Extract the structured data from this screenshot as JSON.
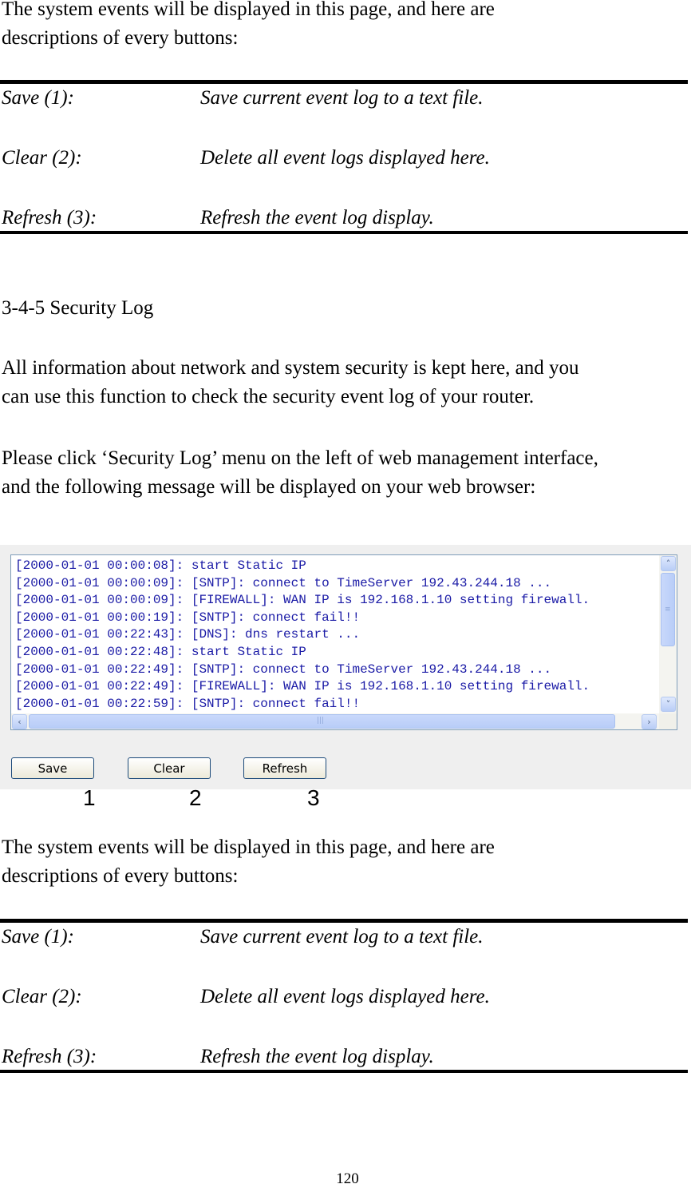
{
  "intro_top": {
    "line1": "The system events will be displayed in this page, and here are",
    "line2": "descriptions of every buttons:"
  },
  "descriptions_top": [
    {
      "name": "Save (1):",
      "text": "Save current event log to a text file."
    },
    {
      "name": "Clear (2):",
      "text": "Delete all event logs displayed here."
    },
    {
      "name": "Refresh (3):",
      "text": "Refresh the event log display."
    }
  ],
  "section_heading": "3-4-5 Security Log",
  "para1": {
    "line1": "All information about network and system security is kept here, and you",
    "line2": "can use this function to check the security event log of your router."
  },
  "para2": {
    "line1": "Please click ‘Security Log’ menu on the left of web management interface,",
    "line2": "and the following message will be displayed on your web browser:"
  },
  "log_panel": {
    "lines": [
      "[2000-01-01 00:00:08]: start Static IP",
      "[2000-01-01 00:00:09]: [SNTP]: connect to TimeServer 192.43.244.18 ...",
      "[2000-01-01 00:00:09]: [FIREWALL]: WAN IP is 192.168.1.10 setting firewall.",
      "[2000-01-01 00:00:19]: [SNTP]: connect fail!!",
      "[2000-01-01 00:22:43]: [DNS]: dns restart ...",
      "[2000-01-01 00:22:48]: start Static IP",
      "[2000-01-01 00:22:49]: [SNTP]: connect to TimeServer 192.43.244.18 ...",
      "[2000-01-01 00:22:49]: [FIREWALL]: WAN IP is 192.168.1.10 setting firewall.",
      "[2000-01-01 00:22:59]: [SNTP]: connect fail!!"
    ],
    "buttons": {
      "save": "Save",
      "clear": "Clear",
      "refresh": "Refresh"
    },
    "callouts": [
      "1",
      "2",
      "3"
    ],
    "icons": {
      "up": "˄",
      "down": "˅",
      "left": "‹",
      "right": "›"
    },
    "colors": {
      "log_text": "#1a1aa6",
      "panel_bg": "#efefef",
      "button_border": "#1c4a7a"
    }
  },
  "intro_bottom": {
    "line1": "The system events will be displayed in this page, and here are",
    "line2": "descriptions of every buttons:"
  },
  "descriptions_bottom": [
    {
      "name": "Save (1):",
      "text": "Save current event log to a text file."
    },
    {
      "name": "Clear (2):",
      "text": "Delete all event logs displayed here."
    },
    {
      "name": "Refresh (3):",
      "text": "Refresh the event log display."
    }
  ],
  "page_number": "120"
}
